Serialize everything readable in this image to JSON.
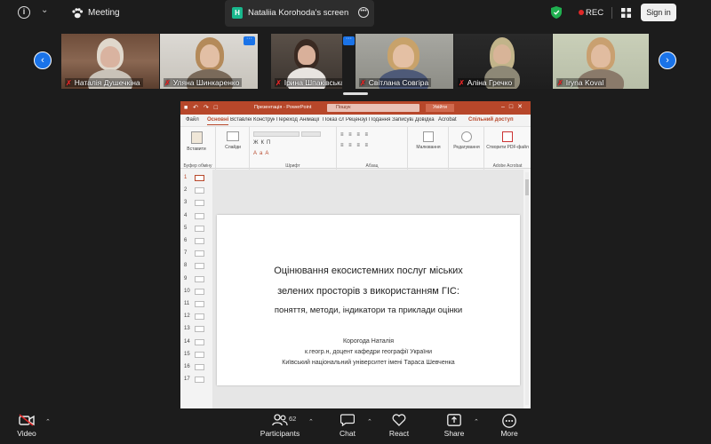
{
  "topbar": {
    "meeting_label": "Meeting",
    "share_badge": "H",
    "share_title": "Nataliia Korohoda's screen",
    "rec_label": "REC",
    "signin_label": "Sign in"
  },
  "participants": [
    {
      "name": "Наталія Душечкіна",
      "muted": true
    },
    {
      "name": "Уляна Шинкаренко",
      "muted": true
    },
    {
      "name": "Ірина Шпаківська",
      "muted": true
    },
    {
      "name": "Світлана Совгіра",
      "muted": true
    },
    {
      "name": "Аліна Гречко",
      "muted": true
    },
    {
      "name": "Iryna Koval",
      "muted": true
    }
  ],
  "powerpoint": {
    "title_bar": {
      "filename": "Презентація - PowerPoint",
      "search_placeholder": "Пошук",
      "signin": "Увійти"
    },
    "tabs": [
      "Файл",
      "Основні",
      "Вставлення",
      "Конструктор",
      "Переходи",
      "Анімації",
      "Показ слайдів",
      "Рецензування",
      "Подання",
      "Записування",
      "Довідка",
      "Acrobat"
    ],
    "share_label": "Спільний доступ",
    "ribbon": {
      "paste": "Вставити",
      "slides": "Слайди",
      "draw": "Малювання",
      "edit": "Редагування",
      "pdf": "Створити PDF-файл",
      "groups": [
        "Буфер обміну",
        "Шрифт",
        "Абзац",
        "Adobe Acrobat"
      ]
    },
    "slide_numbers": [
      "1",
      "2",
      "3",
      "4",
      "5",
      "6",
      "7",
      "8",
      "9",
      "10",
      "11",
      "12",
      "13",
      "14",
      "15",
      "16",
      "17"
    ],
    "slide": {
      "title_line1": "Оцінювання екосистемних послуг міських",
      "title_line2": "зелених просторів з використанням ГІС:",
      "subtitle": "поняття, методи, індикатори та приклади оцінки",
      "author": "Корогода Наталія",
      "position": "к.геогр.н, доцент кафедри географії України",
      "university": "Київський національний університет імені Тараса Шевченка"
    }
  },
  "bottombar": {
    "video": "Video",
    "participants": "Participants",
    "participant_count": "62",
    "chat": "Chat",
    "react": "React",
    "share": "Share",
    "more": "More"
  }
}
